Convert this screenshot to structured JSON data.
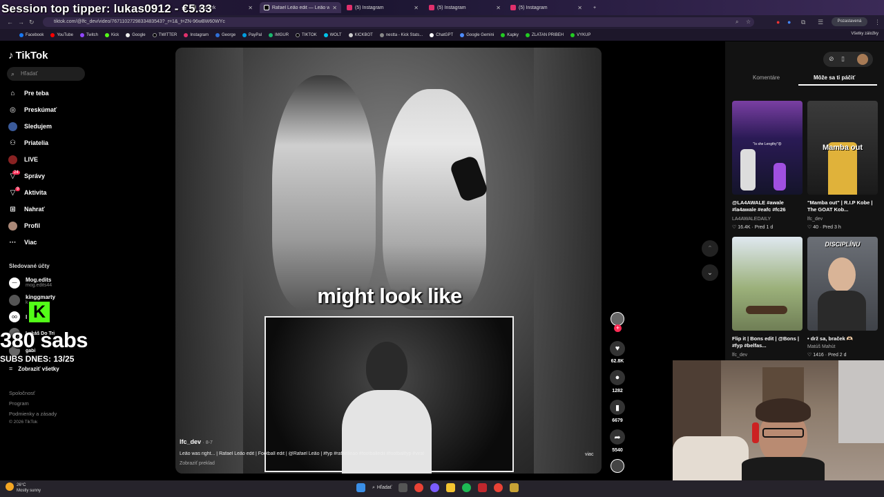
{
  "overlay": {
    "tipper": "Session top tipper: lukas0912 - €5.33",
    "subs": "380 sabs",
    "subs_today": "SUBS DNES: 13/25"
  },
  "browser": {
    "tabs": [
      {
        "label": "@userk",
        "active": false
      },
      {
        "label": "Rafael Leão edit — Leão was r",
        "active": true
      },
      {
        "label": "(5) Instagram",
        "active": false
      },
      {
        "label": "(5) Instagram",
        "active": false
      },
      {
        "label": "(5) Instagram",
        "active": false
      }
    ],
    "url": "tiktok.com/@lfc_dev/video/7671102729833483543?_r=1&_t=ZN-96wBW60WYc",
    "profile_label": "Pozastavená",
    "bookmarks": [
      "Facebook",
      "YouTube",
      "Twitch",
      "Kick",
      "Google",
      "TWITTER",
      "Instagram",
      "George",
      "PayPal",
      "IMGUR",
      "TIKTOK",
      "WOLT",
      "KICKBOT",
      "nestta - Kick Stats...",
      "ChatGPT",
      "Google Gemini",
      "Kapky",
      "ZLATAN PRIBEH",
      "VYKUP"
    ],
    "all_bookmarks": "Všetky záložky"
  },
  "tiktok": {
    "logo": "TikTok",
    "search_placeholder": "Hľadať",
    "nav": [
      {
        "label": "Pre teba",
        "icon": "home-icon"
      },
      {
        "label": "Preskúmať",
        "icon": "compass-icon"
      },
      {
        "label": "Sledujem",
        "icon": "following-icon"
      },
      {
        "label": "Priatelia",
        "icon": "friends-icon"
      },
      {
        "label": "LIVE",
        "icon": "live-icon"
      },
      {
        "label": "Správy",
        "icon": "messages-icon",
        "badge": "24"
      },
      {
        "label": "Aktivita",
        "icon": "activity-icon",
        "badge": "9"
      },
      {
        "label": "Nahrať",
        "icon": "upload-icon"
      },
      {
        "label": "Profil",
        "icon": "profile-icon"
      },
      {
        "label": "Viac",
        "icon": "more-icon"
      }
    ],
    "followed_heading": "Sledované účty",
    "followed": [
      {
        "name": "Mog.edits",
        "handle": "mog.edits44"
      },
      {
        "name": "kinggmarty",
        "handle": "k"
      },
      {
        "name": "l",
        "handle": ""
      },
      {
        "name": "Lukáš Do Tri",
        "handle": ""
      },
      {
        "name": "gabi",
        "handle": ""
      }
    ],
    "show_all": "Zobraziť všetky",
    "footer": [
      "Spoločnosť",
      "Program",
      "Podmienky a zásady",
      "© 2026 TikTok"
    ]
  },
  "video": {
    "caption_overlay": "might look like",
    "author": "lfc_dev",
    "date": "· 8-7",
    "description": "Leão was right... | Rafael Leão edit | Football edit | @Rafael Leão | #fyp #rafaelleao #footballedit #footballfyp #viral",
    "translate": "Zobraziť preklad",
    "more": "viac",
    "likes": "62.8K",
    "comments": "1282",
    "saves": "6679",
    "shares": "5540"
  },
  "right_panel": {
    "tabs": [
      "Komentáre",
      "Môže sa ti páčiť"
    ],
    "active_tab": 1,
    "cards": [
      {
        "title": "@LA4AWALE #awale #la4awale #eafc #fc26",
        "user": "LA4AWALEDAILY",
        "likes": "16.4K",
        "age": "Pred 1 d",
        "thumb_text": "\"Is she Lengthy\"😍"
      },
      {
        "title": "\"Mamba out\" | R.I.P Kobe | The GOAT Kob...",
        "user": "lfc_dev",
        "likes": "40",
        "age": "Pred 3 h",
        "thumb_text": "Mamba out"
      },
      {
        "title": "Flip it | Bons edit | @Bons | #fyp #belfas...",
        "user": "lfc_dev",
        "likes": "",
        "age": "",
        "thumb_text": ""
      },
      {
        "title": "• drž sa, braček 🫶🏻",
        "user": "Matúš Mahút",
        "likes": "1416",
        "age": "Pred 2 d",
        "thumb_text": "DISCIPLÍNU"
      }
    ]
  },
  "taskbar": {
    "temp": "26°C",
    "weather": "Mostly sunny",
    "search": "Hľadať"
  },
  "colors": {
    "accent": "#fe2c55",
    "kick_green": "#53fc18",
    "panel_bg": "#121212"
  }
}
